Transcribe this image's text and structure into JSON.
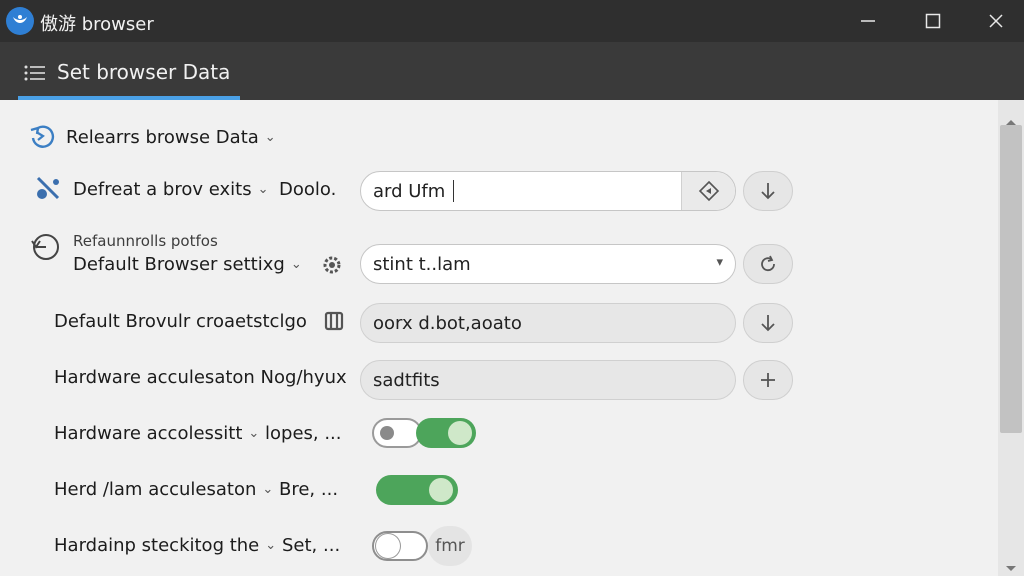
{
  "titlebar": {
    "title": "傲游 browser"
  },
  "header": {
    "title": "Set browser Data"
  },
  "rows": {
    "r1": {
      "label": "Relearrs browse Data"
    },
    "r2": {
      "label": "Defreat a brov exits",
      "sublabel": "Doolo.",
      "field_value": "ard Ufm"
    },
    "r3": {
      "caption": "Refaunnrolls potfos",
      "label": "Default Browser settixg",
      "field_value": "stint t..lam"
    },
    "r4": {
      "label": "Default Brovulr croaetstclgo",
      "field_value": "oorx d.bot,aoato"
    },
    "r5": {
      "label": "Hardware acculesaton Nog/hyux",
      "field_value": "sadtfits"
    },
    "r6": {
      "label": "Hardware accolessitt",
      "sublabel": "lopes, ..."
    },
    "r7": {
      "label": "Herd /lam acculesaton",
      "sublabel": "Bre, ..."
    },
    "r8": {
      "label": "Hardainp steckitog the",
      "sublabel": "Set, ...",
      "toggle_caption": "fmr"
    }
  },
  "toggles": {
    "r6": true,
    "r7": true,
    "r8": false
  },
  "colors": {
    "accent": "#4aa0e6",
    "toggle_on": "#4da55b",
    "titlebar": "#2f2f2f",
    "header": "#3a3a3a"
  }
}
